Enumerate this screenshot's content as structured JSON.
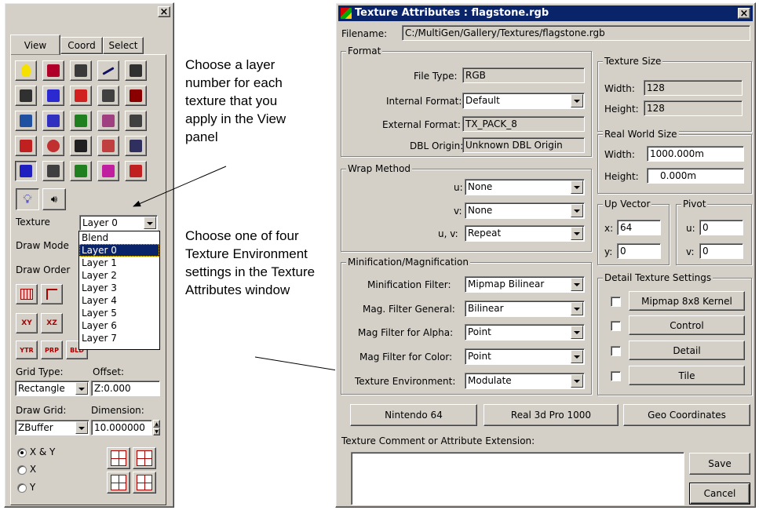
{
  "left_panel": {
    "close_glyph": "×",
    "tabs": [
      "View",
      "Coord",
      "Select"
    ],
    "tool_icons": [
      "light-bulb-icon",
      "texture-face-icon",
      "move-vertex-icon",
      "line-icon",
      "ir-icon",
      "wire-cube-icon",
      "select-face-icon",
      "dotted-line-icon",
      "box-icon",
      "gate-icon",
      "shaded-cube-icon",
      "group-select-icon",
      "curve-icon",
      "material-icon",
      "antenna-icon",
      "brick-icon",
      "sphere-icon",
      "hz-icon",
      "pattern-icon",
      "puzzle-icon",
      "blue-grid-icon",
      "screen-icon",
      "green-grid-icon",
      "paint-icon",
      "arrow-down-icon"
    ],
    "extra_icons": [
      "bulb-outline-icon",
      "sound-icon"
    ],
    "texture_label": "Texture",
    "texture_value": "Layer 0",
    "draw_mode_label": "Draw Mode",
    "draw_order_label": "Draw Order",
    "layer_options": [
      "Blend",
      "Layer 0",
      "Layer 1",
      "Layer 2",
      "Layer 3",
      "Layer 4",
      "Layer 5",
      "Layer 6",
      "Layer 7"
    ],
    "layer_selected": "Layer 0",
    "view_buttons": [
      "XY",
      "XZ",
      "YTR",
      "PRP",
      "BLD"
    ],
    "grid_type_label": "Grid Type:",
    "offset_label": "Offset:",
    "grid_type_value": "Rectangle",
    "offset_value": "Z:0.000",
    "draw_grid_label": "Draw Grid:",
    "dimension_label": "Dimension:",
    "draw_grid_value": "ZBuffer",
    "dimension_value": "10.000000",
    "radio_xy": "X & Y",
    "radio_x": "X",
    "radio_y": "Y"
  },
  "annotations": {
    "note1": "Choose a layer number for each texture that you apply in the View panel",
    "note2": "Choose one of four Texture Environment settings in the Texture Attributes window"
  },
  "dialog": {
    "title": "Texture Attributes : flagstone.rgb",
    "close_glyph": "×",
    "filename_label": "Filename:",
    "filename_value": "C:/MultiGen/Gallery/Textures/flagstone.rgb",
    "format": {
      "title": "Format",
      "file_type_label": "File Type:",
      "file_type_value": "RGB",
      "internal_label": "Internal Format:",
      "internal_value": "Default",
      "external_label": "External Format:",
      "external_value": "TX_PACK_8",
      "dbl_label": "DBL Origin:",
      "dbl_value": "Unknown DBL Origin"
    },
    "texture_size": {
      "title": "Texture Size",
      "width_label": "Width:",
      "width_value": "128",
      "height_label": "Height:",
      "height_value": "128"
    },
    "real_world": {
      "title": "Real World Size",
      "width_label": "Width:",
      "width_value": "1000.000m",
      "height_label": "Height:",
      "height_value": "0.000m"
    },
    "wrap": {
      "title": "Wrap Method",
      "u_label": "u:",
      "u_value": "None",
      "v_label": "v:",
      "v_value": "None",
      "uv_label": "u, v:",
      "uv_value": "Repeat"
    },
    "up_vector": {
      "title": "Up Vector",
      "x_label": "x:",
      "x_value": "64",
      "y_label": "y:",
      "y_value": "0"
    },
    "pivot": {
      "title": "Pivot",
      "u_label": "u:",
      "u_value": "0",
      "v_label": "v:",
      "v_value": "0"
    },
    "minmag": {
      "title": "Minification/Magnification",
      "min_label": "Minification Filter:",
      "min_value": "Mipmap Bilinear",
      "mag_label": "Mag. Filter General:",
      "mag_value": "Bilinear",
      "alpha_label": "Mag Filter for Alpha:",
      "alpha_value": "Point",
      "color_label": "Mag Filter for Color:",
      "color_value": "Point",
      "env_label": "Texture Environment:",
      "env_value": "Modulate"
    },
    "detail": {
      "title": "Detail Texture Settings",
      "buttons": [
        "Mipmap 8x8 Kernel",
        "Control",
        "Detail",
        "Tile"
      ]
    },
    "bottom_buttons": [
      "Nintendo 64",
      "Real 3d Pro 1000",
      "Geo Coordinates"
    ],
    "comment_label": "Texture Comment or Attribute Extension:",
    "save_label": "Save",
    "cancel_label": "Cancel"
  }
}
